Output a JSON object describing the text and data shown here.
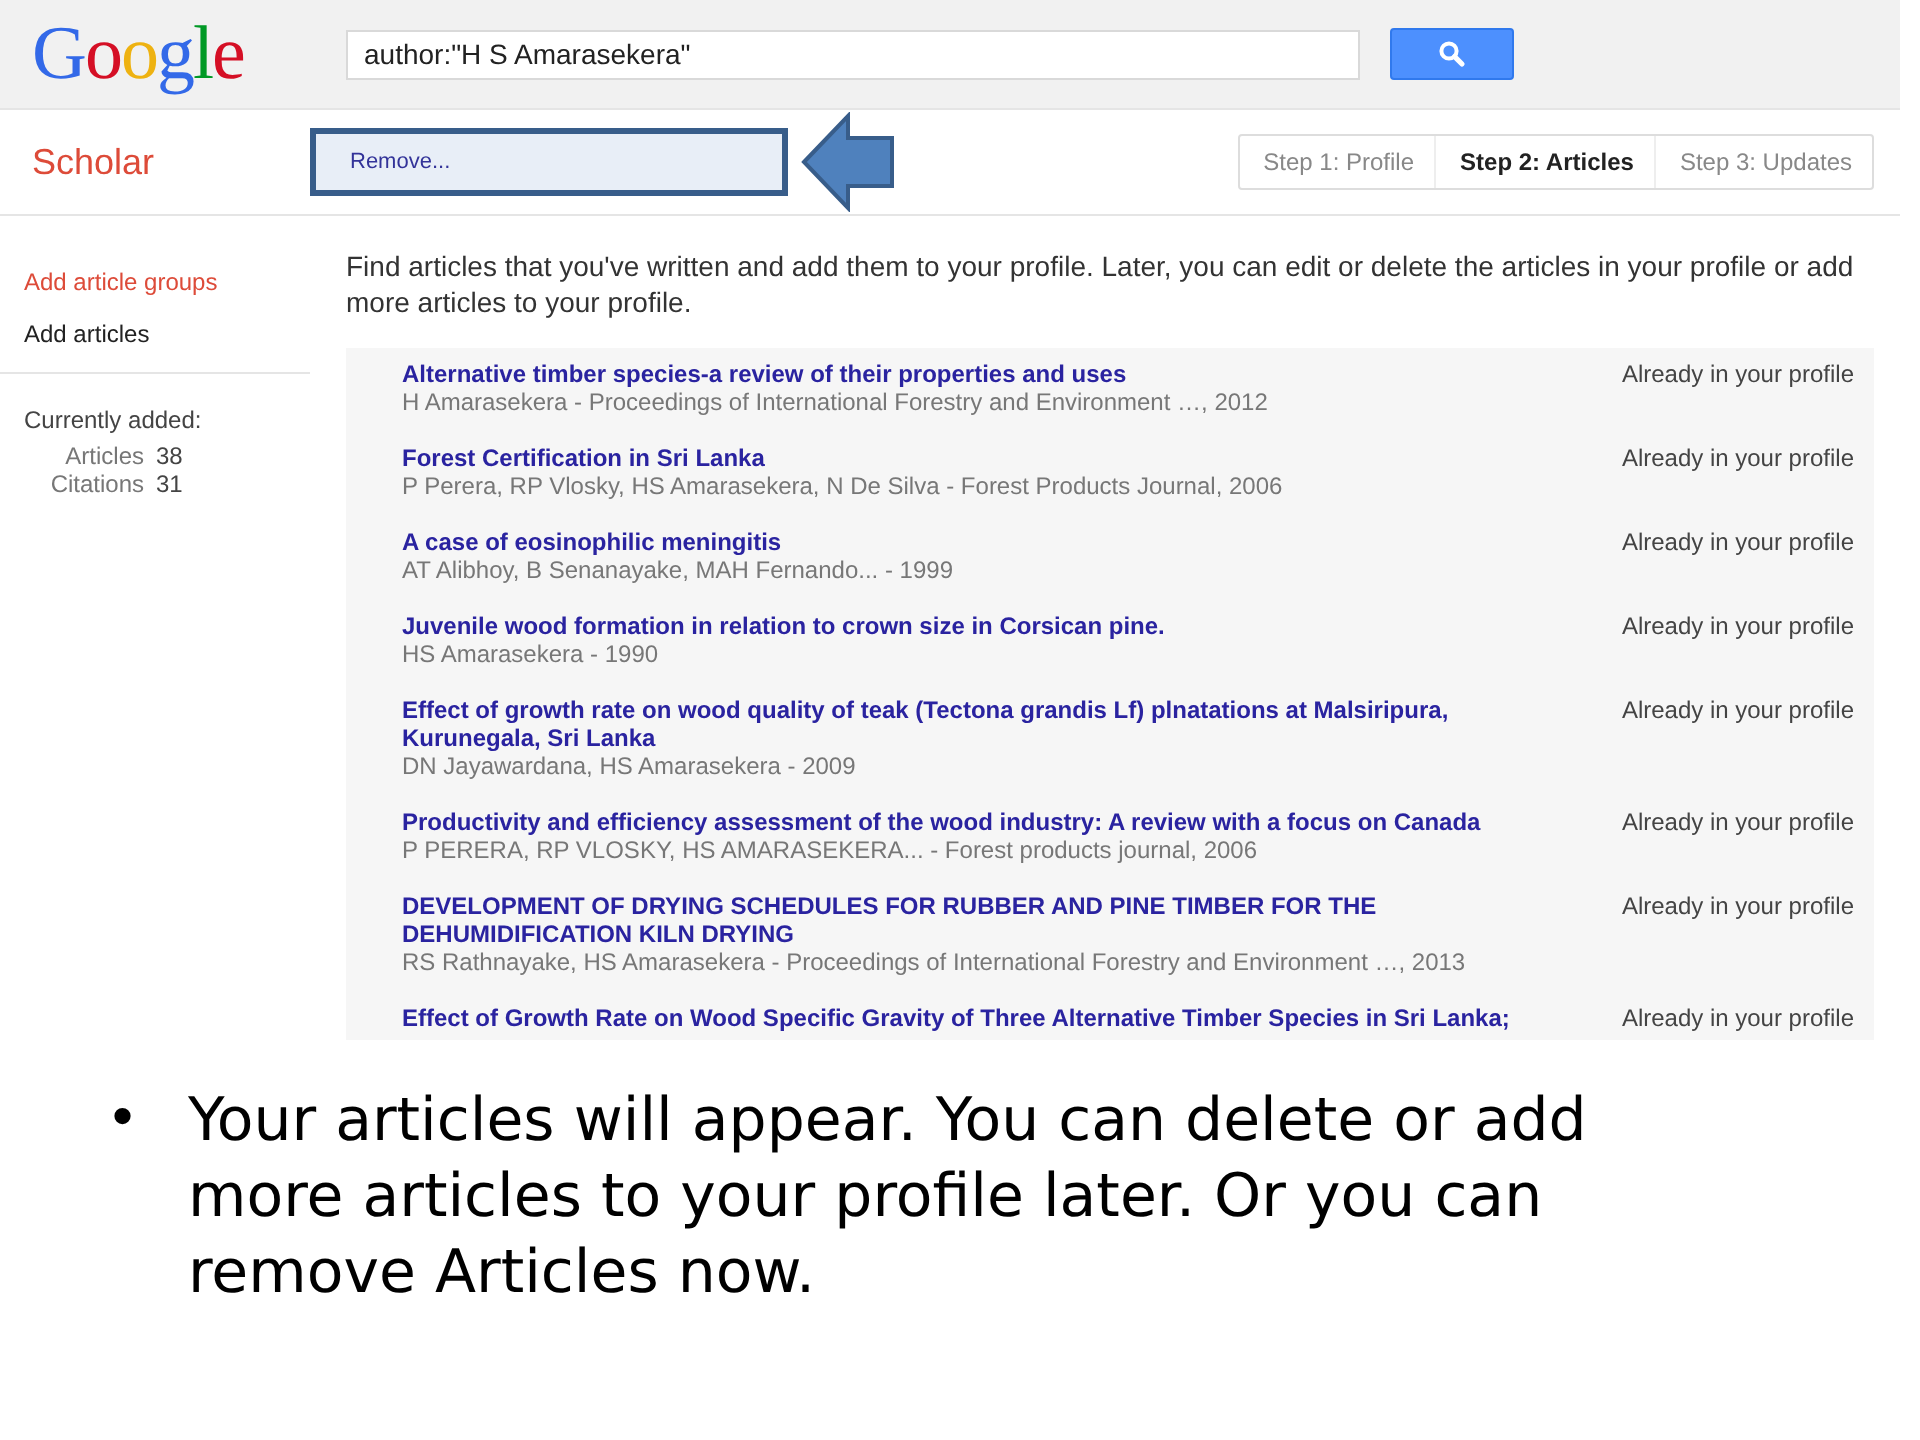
{
  "header": {
    "logo": "Google",
    "search": {
      "value": "author:\"H S Amarasekera\""
    }
  },
  "subheader": {
    "title": "Scholar",
    "action": {
      "label": "Remove...",
      "highlighted": true
    },
    "steps": [
      {
        "label": "Step 1: Profile",
        "selected": false
      },
      {
        "label": "Step 2: Articles",
        "selected": true
      },
      {
        "label": "Step 3: Updates",
        "selected": false
      }
    ]
  },
  "sidebar": {
    "items": [
      {
        "label": "Add article groups",
        "selected": true
      },
      {
        "label": "Add articles",
        "selected": false
      }
    ],
    "currently_added": "Currently added:",
    "stats": [
      {
        "label": "Articles",
        "value": "38"
      },
      {
        "label": "Citations",
        "value": "31"
      }
    ]
  },
  "intro": "Find articles that you've written and add them to your profile. Later, you can edit or delete the articles in your profile or add more articles to your profile.",
  "articles": [
    {
      "title": "Alternative timber species-a review of their properties and uses",
      "meta": "H Amarasekera - Proceedings of International Forestry and Environment …, 2012",
      "status": "Already in your profile"
    },
    {
      "title": "Forest Certification in Sri Lanka",
      "meta": "P Perera, RP Vlosky, HS Amarasekera, N De Silva - Forest Products Journal, 2006",
      "status": "Already in your profile"
    },
    {
      "title": "A case of eosinophilic meningitis",
      "meta": "AT Alibhoy, B Senanayake, MAH Fernando... - 1999",
      "status": "Already in your profile"
    },
    {
      "title": "Juvenile wood formation in relation to crown size in Corsican pine.",
      "meta": "HS Amarasekera - 1990",
      "status": "Already in your profile"
    },
    {
      "title": "Effect of growth rate on wood quality of teak (Tectona grandis Lf) plnatations at Malsiripura, Kurunegala, Sri Lanka",
      "meta": "DN Jayawardana, HS Amarasekera - 2009",
      "status": "Already in your profile"
    },
    {
      "title": "Productivity and efficiency assessment of the wood industry: A review with a focus on Canada",
      "meta": "P PERERA, RP VLOSKY, HS AMARASEKERA... - Forest products journal, 2006",
      "status": "Already in your profile"
    },
    {
      "title": "DEVELOPMENT OF DRYING SCHEDULES FOR RUBBER AND PINE TIMBER FOR THE DEHUMIDIFICATION KILN DRYING",
      "meta": "RS Rathnayake, HS Amarasekera - Proceedings of International Forestry and Environment …, 2013",
      "status": "Already in your profile"
    },
    {
      "title": "Effect of Growth Rate on Wood Specific Gravity of Three Alternative Timber Species in Sri Lanka;",
      "status": "Already in your profile"
    }
  ],
  "slide_bullet": {
    "bullet": "•",
    "text": "Your articles will appear. You can delete or add more articles to your profile later. Or you can remove Articles now."
  }
}
